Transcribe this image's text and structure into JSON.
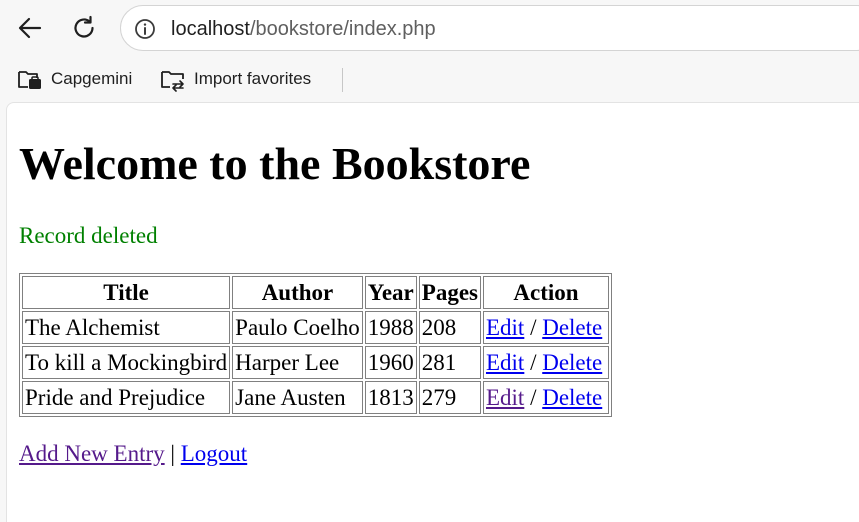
{
  "browser": {
    "url_host": "localhost",
    "url_path": "/bookstore/index.php",
    "favorites": [
      {
        "label": "Capgemini",
        "icon": "folder-icon"
      },
      {
        "label": "Import favorites",
        "icon": "import-folder-icon"
      }
    ]
  },
  "page": {
    "title": "Welcome to the Bookstore",
    "status": "Record deleted",
    "status_color": "#008000",
    "table": {
      "headers": [
        "Title",
        "Author",
        "Year",
        "Pages",
        "Action"
      ],
      "rows": [
        {
          "title": "The Alchemist",
          "author": "Paulo Coelho",
          "year": "1988",
          "pages": "208",
          "edit": "Edit",
          "sep": "/",
          "delete": "Delete"
        },
        {
          "title": "To kill a Mockingbird",
          "author": "Harper Lee",
          "year": "1960",
          "pages": "281",
          "edit": "Edit",
          "sep": "/",
          "delete": "Delete"
        },
        {
          "title": "Pride and Prejudice",
          "author": "Jane Austen",
          "year": "1813",
          "pages": "279",
          "edit": "Edit",
          "sep": "/",
          "delete": "Delete"
        }
      ]
    },
    "footer": {
      "add_label": "Add New Entry",
      "separator": "|",
      "logout_label": "Logout"
    },
    "link_color": "#0000ee",
    "visited_link_color": "#551a8b"
  }
}
